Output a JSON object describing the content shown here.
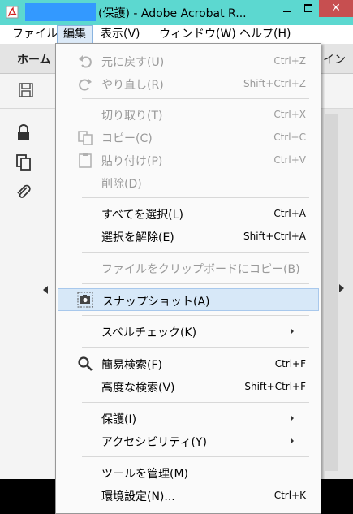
{
  "titlebar": {
    "title": "(保護) - Adobe Acrobat R...",
    "close_glyph": "✕"
  },
  "menubar": {
    "items": [
      "ファイル",
      "編集",
      "表示(V)",
      "ウィンドウ(W)",
      "ヘルプ(H)"
    ],
    "active_index": 1
  },
  "toolbar": {
    "home_tab": "ホーム",
    "right_tab": "イン"
  },
  "edit_menu": {
    "items": [
      {
        "label": "元に戻す(U)",
        "shortcut": "Ctrl+Z",
        "disabled": true,
        "icon": "undo-icon"
      },
      {
        "label": "やり直し(R)",
        "shortcut": "Shift+Ctrl+Z",
        "disabled": true,
        "icon": "redo-icon"
      },
      {
        "label": "切り取り(T)",
        "shortcut": "Ctrl+X",
        "disabled": true
      },
      {
        "label": "コピー(C)",
        "shortcut": "Ctrl+C",
        "disabled": true,
        "icon": "copy-icon"
      },
      {
        "label": "貼り付け(P)",
        "shortcut": "Ctrl+V",
        "disabled": true,
        "icon": "paste-icon"
      },
      {
        "label": "削除(D)",
        "shortcut": "",
        "disabled": true
      },
      {
        "label": "すべてを選択(L)",
        "shortcut": "Ctrl+A",
        "disabled": false
      },
      {
        "label": "選択を解除(E)",
        "shortcut": "Shift+Ctrl+A",
        "disabled": false
      },
      {
        "label": "ファイルをクリップボードにコピー(B)",
        "shortcut": "",
        "disabled": true
      },
      {
        "label": "スナップショット(A)",
        "shortcut": "",
        "disabled": false,
        "icon": "camera-icon",
        "highlighted": true
      },
      {
        "label": "スペルチェック(K)",
        "shortcut": "",
        "disabled": false,
        "submenu": true
      },
      {
        "label": "簡易検索(F)",
        "shortcut": "Ctrl+F",
        "disabled": false,
        "icon": "search-icon"
      },
      {
        "label": "高度な検索(V)",
        "shortcut": "Shift+Ctrl+F",
        "disabled": false
      },
      {
        "label": "保護(I)",
        "shortcut": "",
        "disabled": false,
        "submenu": true
      },
      {
        "label": "アクセシビリティ(Y)",
        "shortcut": "",
        "disabled": false,
        "submenu": true
      },
      {
        "label": "ツールを管理(M)",
        "shortcut": "",
        "disabled": false
      },
      {
        "label": "環境設定(N)...",
        "shortcut": "Ctrl+K",
        "disabled": false
      }
    ]
  },
  "colors": {
    "titlebar": "#5cd8d0",
    "title_highlight": "#3399ff",
    "close_button": "#c74f50",
    "menu_highlight": "#d7e8f8",
    "disabled_text": "#9a9a9a"
  }
}
